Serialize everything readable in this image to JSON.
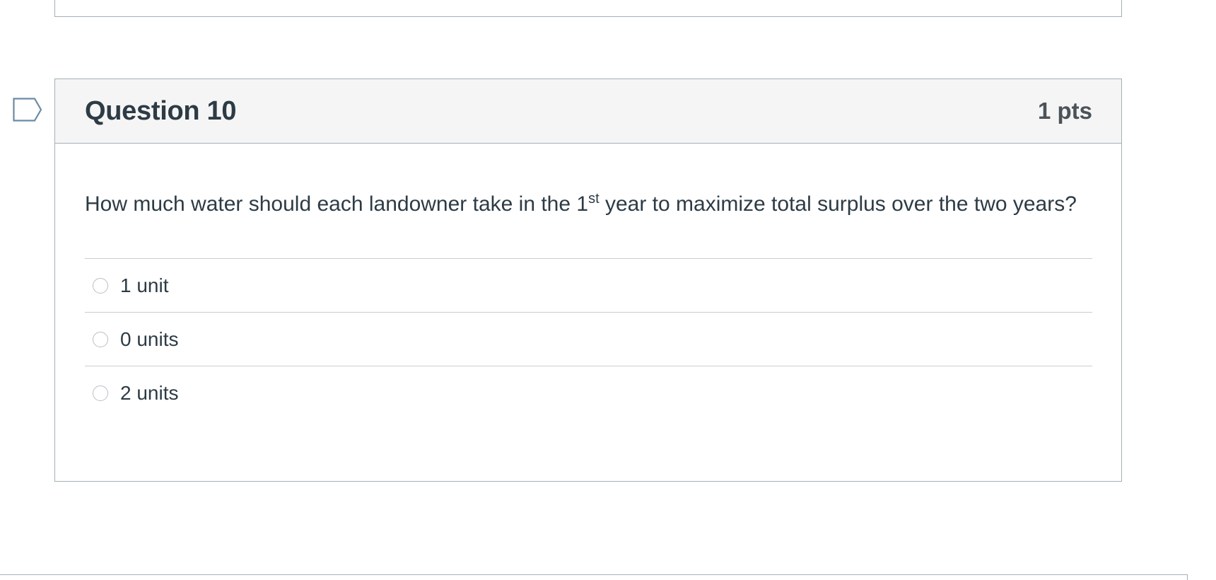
{
  "question": {
    "title": "Question 10",
    "points": "1 pts",
    "text_before": "How much water should each landowner take in the 1",
    "text_superscript": "st",
    "text_after": " year to maximize total surplus over the two years?",
    "answers": [
      {
        "label": "1 unit"
      },
      {
        "label": "0 units"
      },
      {
        "label": "2 units"
      }
    ]
  },
  "icons": {
    "flag": "flag-marker-icon",
    "radio": "radio-unchecked-icon"
  },
  "colors": {
    "header_bg": "#f5f5f5",
    "border": "#a5afb5",
    "text": "#2d3b45",
    "flag_stroke": "#6b8ba4"
  }
}
